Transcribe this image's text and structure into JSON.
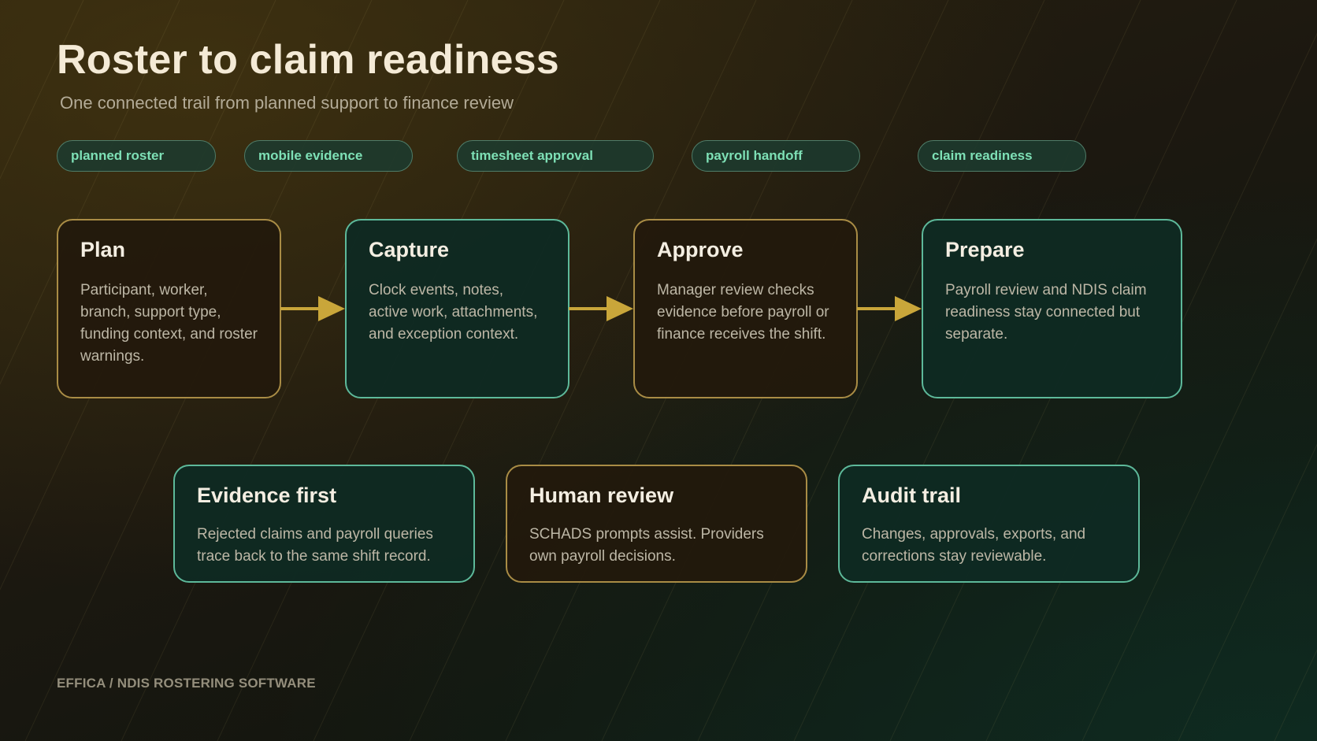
{
  "title": "Roster to claim readiness",
  "subtitle": "One connected trail from planned support to finance review",
  "chips": [
    "planned roster",
    "mobile evidence",
    "timesheet approval",
    "payroll handoff",
    "claim readiness"
  ],
  "flow": [
    {
      "title": "Plan",
      "body": "Participant, worker, branch, support type, funding context, and roster warnings.",
      "tone": "gold"
    },
    {
      "title": "Capture",
      "body": "Clock events, notes, active work, attachments, and exception context.",
      "tone": "teal"
    },
    {
      "title": "Approve",
      "body": "Manager review checks evidence before payroll or finance receives the shift.",
      "tone": "gold"
    },
    {
      "title": "Prepare",
      "body": "Payroll review and NDIS claim readiness stay connected but separate.",
      "tone": "teal"
    }
  ],
  "principles": [
    {
      "title": "Evidence first",
      "body": "Rejected claims and payroll queries trace back to the same shift record.",
      "tone": "teal"
    },
    {
      "title": "Human review",
      "body": "SCHADS prompts assist. Providers own payroll decisions.",
      "tone": "gold"
    },
    {
      "title": "Audit trail",
      "body": "Changes, approvals, exports, and corrections stay reviewable.",
      "tone": "teal"
    }
  ],
  "footer": "EFFICA / NDIS ROSTERING SOFTWARE",
  "colors": {
    "gold_border": "#a98c45",
    "teal_border": "#5db99a",
    "arrow": "#c9a63a",
    "chip_text": "#7ee0b6",
    "title": "#f4ead6"
  }
}
